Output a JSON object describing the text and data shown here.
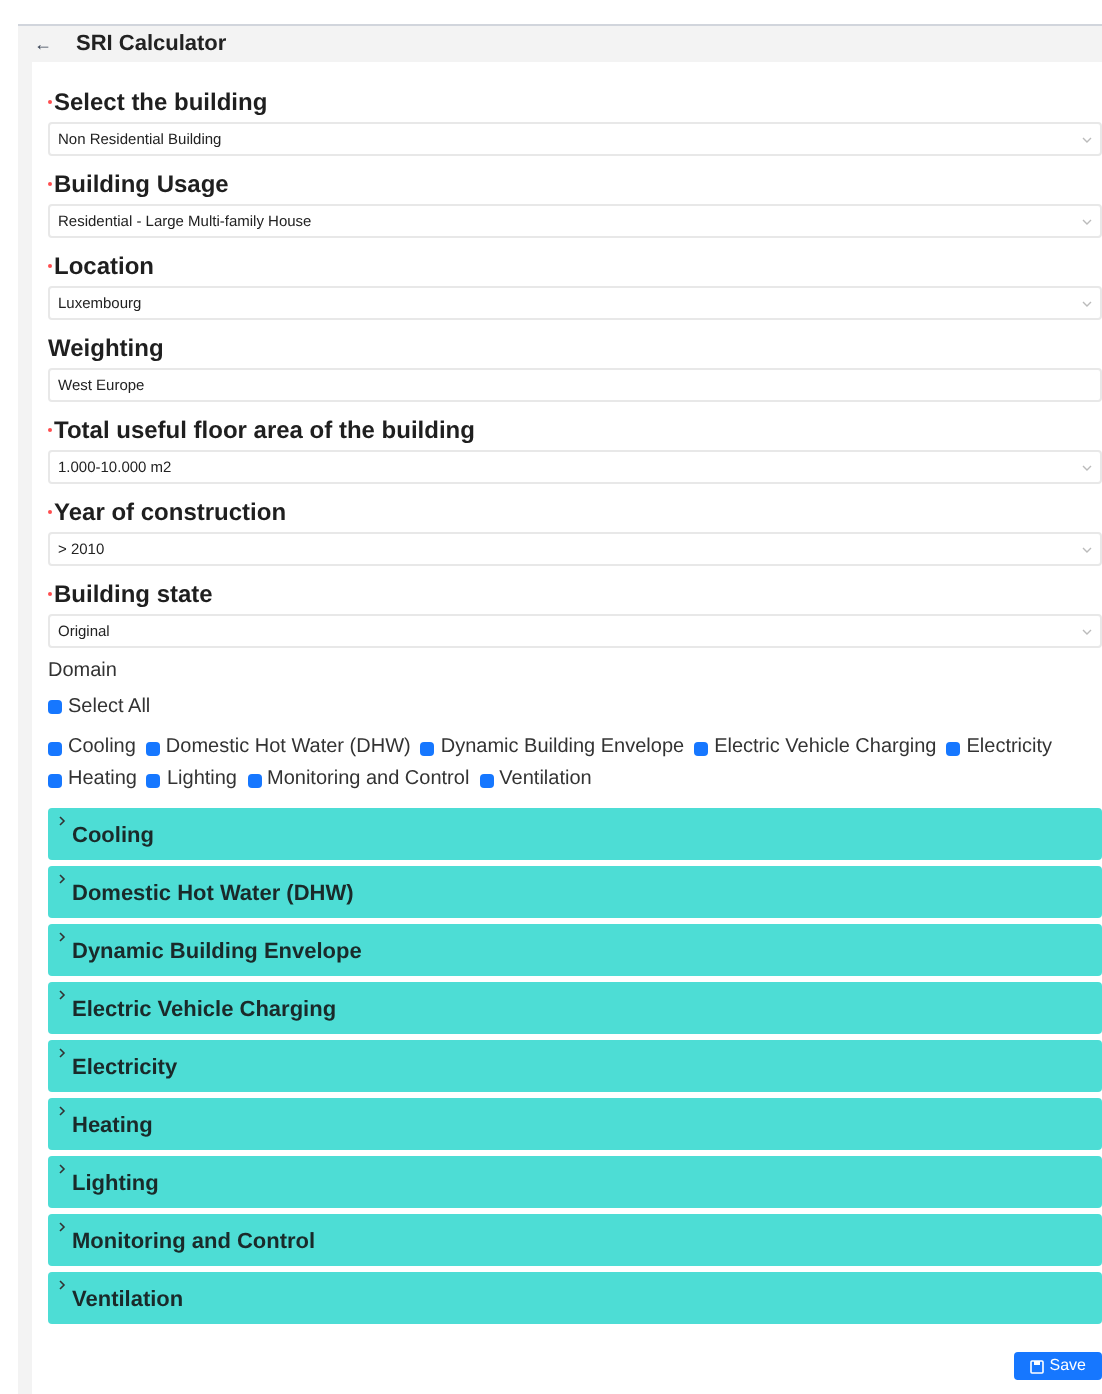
{
  "header": {
    "back": "←",
    "title": "SRI Calculator"
  },
  "fields": [
    {
      "label": "Select the building",
      "required": true,
      "value": "Non Residential Building",
      "dropdown": true
    },
    {
      "label": "Building Usage",
      "required": true,
      "value": "Residential - Large Multi-family House",
      "dropdown": true
    },
    {
      "label": "Location",
      "required": true,
      "value": "Luxembourg",
      "dropdown": true
    },
    {
      "label": "Weighting",
      "required": false,
      "value": "West Europe",
      "dropdown": false
    },
    {
      "label": "Total useful floor area of the building",
      "required": true,
      "value": "1.000-10.000 m2",
      "dropdown": true
    },
    {
      "label": "Year of construction",
      "required": true,
      "value": "> 2010",
      "dropdown": true
    },
    {
      "label": "Building state",
      "required": true,
      "value": "Original",
      "dropdown": true
    }
  ],
  "domain": {
    "label": "Domain",
    "select_all": {
      "label": "Select All",
      "checked": true
    },
    "options": [
      {
        "label": "Cooling",
        "checked": true
      },
      {
        "label": "Domestic Hot Water (DHW)",
        "checked": true
      },
      {
        "label": "Dynamic Building Envelope",
        "checked": true
      },
      {
        "label": "Electric Vehicle Charging",
        "checked": true
      },
      {
        "label": "Electricity",
        "checked": true
      },
      {
        "label": "Heating",
        "checked": true
      },
      {
        "label": "Lighting",
        "checked": true
      },
      {
        "label": "Monitoring and Control",
        "checked": true
      },
      {
        "label": "Ventilation",
        "checked": true
      }
    ]
  },
  "sections": [
    {
      "title": "Cooling",
      "expanded": false
    },
    {
      "title": "Domestic Hot Water (DHW)",
      "expanded": false
    },
    {
      "title": "Dynamic Building Envelope",
      "expanded": false
    },
    {
      "title": "Electric Vehicle Charging",
      "expanded": false
    },
    {
      "title": "Electricity",
      "expanded": false
    },
    {
      "title": "Heating",
      "expanded": false
    },
    {
      "title": "Lighting",
      "expanded": false
    },
    {
      "title": "Monitoring and Control",
      "expanded": false
    },
    {
      "title": "Ventilation",
      "expanded": false
    }
  ],
  "save_button": {
    "label": "Save"
  }
}
